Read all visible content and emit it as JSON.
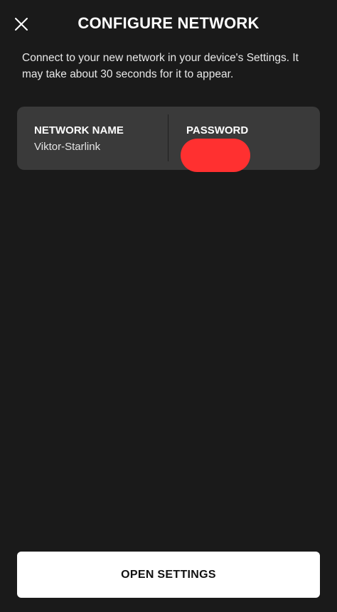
{
  "header": {
    "title": "CONFIGURE NETWORK",
    "close_icon": "close-icon"
  },
  "instructions": "Connect to your new network in your device's Settings. It may take about 30 seconds for it to appear.",
  "network_card": {
    "name_label": "NETWORK NAME",
    "name_value": "Viktor-Starlink",
    "password_label": "PASSWORD",
    "password_redaction_color": "#ff3030"
  },
  "footer": {
    "open_settings_label": "OPEN SETTINGS"
  },
  "colors": {
    "background": "#1a1a1a",
    "card": "#3a3a3a",
    "button": "#ffffff"
  }
}
